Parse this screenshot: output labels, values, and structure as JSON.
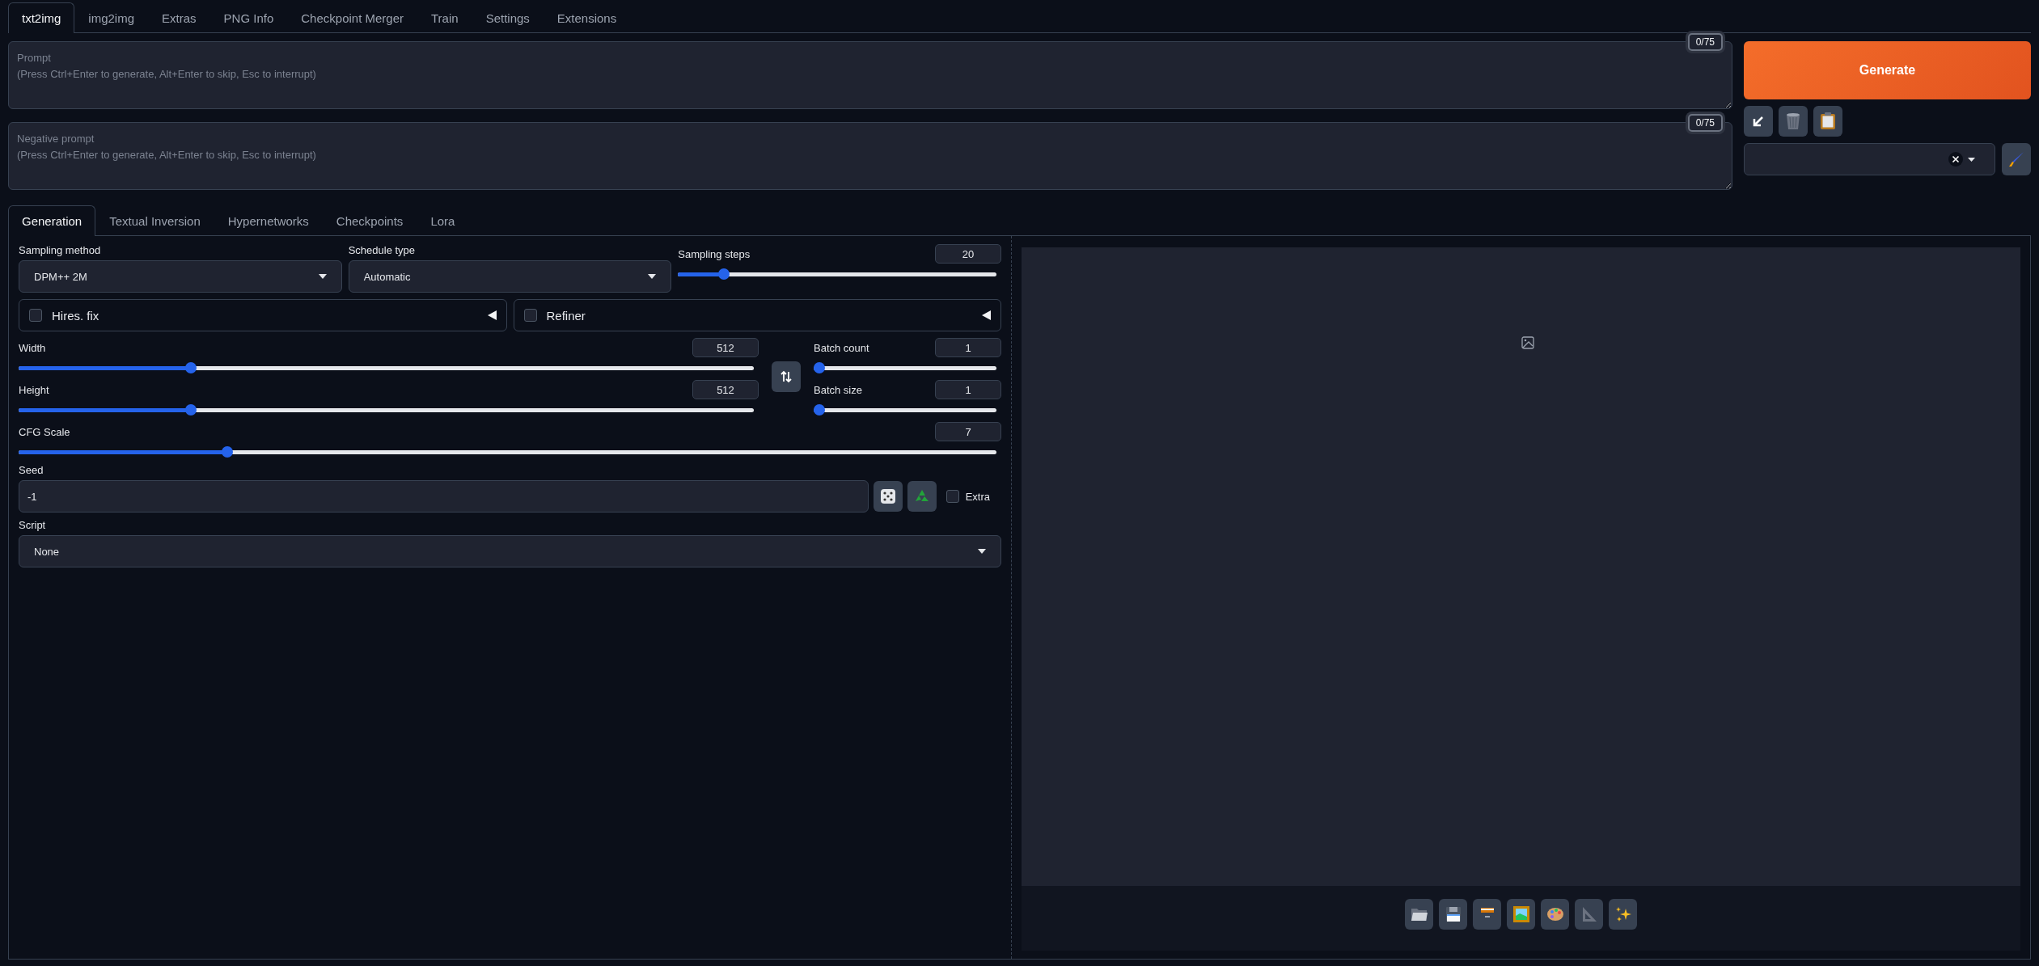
{
  "top_tabs": [
    {
      "label": "txt2img",
      "selected": true
    },
    {
      "label": "img2img",
      "selected": false
    },
    {
      "label": "Extras",
      "selected": false
    },
    {
      "label": "PNG Info",
      "selected": false
    },
    {
      "label": "Checkpoint Merger",
      "selected": false
    },
    {
      "label": "Train",
      "selected": false
    },
    {
      "label": "Settings",
      "selected": false
    },
    {
      "label": "Extensions",
      "selected": false
    }
  ],
  "prompts": [
    {
      "placeholder": "Prompt\n(Press Ctrl+Enter to generate, Alt+Enter to skip, Esc to interrupt)",
      "token_count": "0/75"
    },
    {
      "placeholder": "Negative prompt\n(Press Ctrl+Enter to generate, Alt+Enter to skip, Esc to interrupt)",
      "token_count": "0/75"
    }
  ],
  "generate_button": "Generate",
  "sub_tabs": [
    {
      "label": "Generation",
      "selected": true
    },
    {
      "label": "Textual Inversion",
      "selected": false
    },
    {
      "label": "Hypernetworks",
      "selected": false
    },
    {
      "label": "Checkpoints",
      "selected": false
    },
    {
      "label": "Lora",
      "selected": false
    }
  ],
  "sampling_method": {
    "label": "Sampling method",
    "value": "DPM++ 2M"
  },
  "schedule_type": {
    "label": "Schedule type",
    "value": "Automatic"
  },
  "sampling_steps": {
    "label": "Sampling steps",
    "value": "20",
    "level": 0.13
  },
  "hires_fix": {
    "label": "Hires. fix",
    "checked": false
  },
  "refiner": {
    "label": "Refiner",
    "checked": false
  },
  "width": {
    "label": "Width",
    "value": "512",
    "level": 0.23
  },
  "height": {
    "label": "Height",
    "value": "512",
    "level": 0.23
  },
  "batch_count": {
    "label": "Batch count",
    "value": "1",
    "level": 0
  },
  "batch_size": {
    "label": "Batch size",
    "value": "1",
    "level": 0
  },
  "cfg_scale": {
    "label": "CFG Scale",
    "value": "7",
    "level": 0.21
  },
  "seed": {
    "label": "Seed",
    "value": "-1"
  },
  "extra": {
    "label": "Extra",
    "checked": false
  },
  "script": {
    "label": "Script",
    "value": "None"
  }
}
